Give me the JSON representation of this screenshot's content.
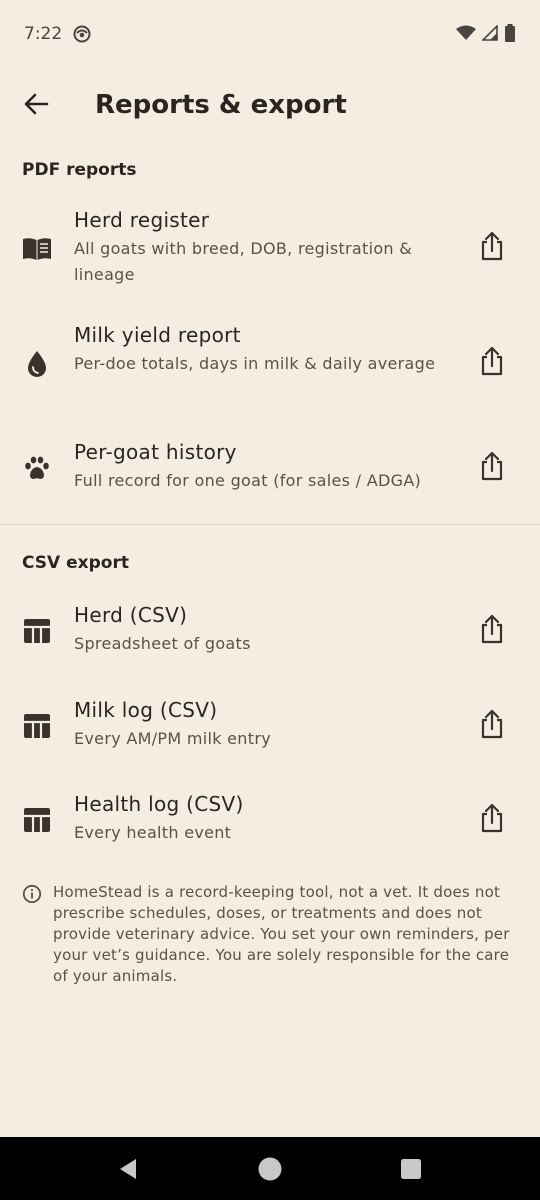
{
  "status_bar": {
    "time": "7:22"
  },
  "header": {
    "title": "Reports & export",
    "back_icon": "arrow-back-icon"
  },
  "sections": {
    "pdf": {
      "title": "PDF reports",
      "items": [
        {
          "title": "Herd register",
          "subtitle": "All goats with breed, DOB, registration & lineage",
          "icon": "book-icon"
        },
        {
          "title": "Milk yield report",
          "subtitle": "Per-doe totals, days in milk & daily average",
          "icon": "drop-icon"
        },
        {
          "title": "Per-goat history",
          "subtitle": "Full record for one goat (for sales / ADGA)",
          "icon": "paw-icon"
        }
      ]
    },
    "csv": {
      "title": "CSV export",
      "items": [
        {
          "title": "Herd (CSV)",
          "subtitle": "Spreadsheet of goats",
          "icon": "table-icon"
        },
        {
          "title": "Milk log (CSV)",
          "subtitle": "Every AM/PM milk entry",
          "icon": "table-icon"
        },
        {
          "title": "Health log (CSV)",
          "subtitle": "Every health event",
          "icon": "table-icon"
        }
      ]
    }
  },
  "disclaimer": {
    "text": "HomeStead is a record-keeping tool, not a vet. It does not prescribe schedules, doses, or treatments and does not provide veterinary advice. You set your own reminders, per your vet’s guidance. You are solely responsible for the care of your animals."
  },
  "colors": {
    "background": "#f5ede1",
    "text": "#2a2520",
    "subtext": "#5a5248",
    "icon": "#3a332d"
  }
}
